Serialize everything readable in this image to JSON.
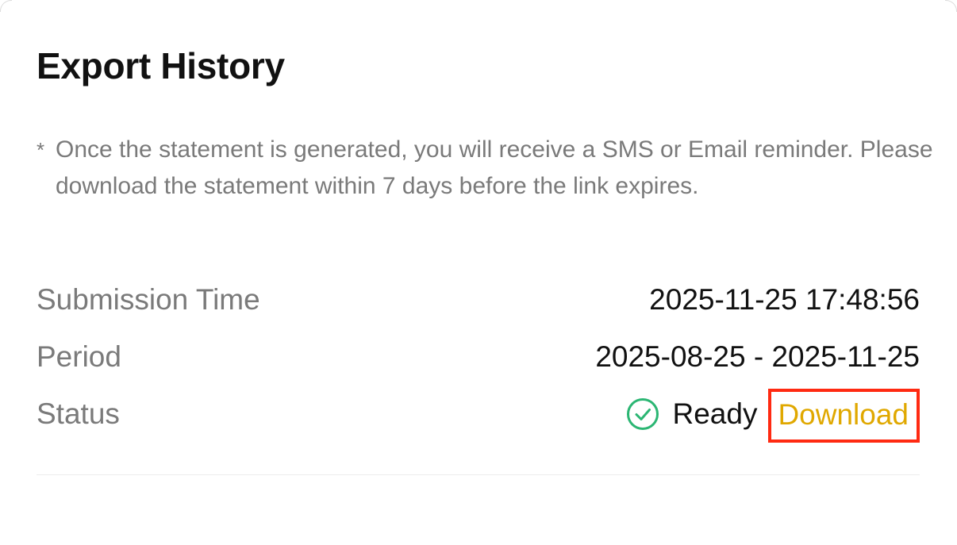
{
  "header": {
    "title": "Export History"
  },
  "notice": {
    "marker": "*",
    "text": "Once the statement is generated, you will receive a SMS or Email reminder. Please download the statement within 7 days before the link expires."
  },
  "details": {
    "submission_time": {
      "label": "Submission Time",
      "value": "2025-11-25 17:48:56"
    },
    "period": {
      "label": "Period",
      "value": "2025-08-25 - 2025-11-25"
    },
    "status": {
      "label": "Status",
      "icon": "check-circle-icon",
      "value": "Ready",
      "action_label": "Download"
    }
  },
  "colors": {
    "accent_download": "#e0a800",
    "status_ready": "#2bb673",
    "highlight_box": "#ff2a12"
  }
}
